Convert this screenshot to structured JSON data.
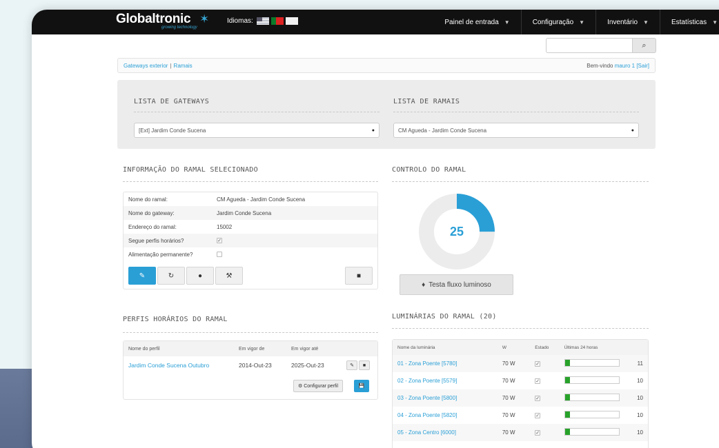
{
  "header": {
    "logo_text": "Globaltronic",
    "logo_sub": "growing technology",
    "idiomas_label": "Idiomas:",
    "nav": [
      {
        "label": "Painel de entrada"
      },
      {
        "label": "Configuração"
      },
      {
        "label": "Inventário"
      },
      {
        "label": "Estatísticas"
      }
    ]
  },
  "search": {
    "placeholder": "",
    "button_icon": "search-icon"
  },
  "breadcrumb": {
    "item1": "Gateways exterior",
    "sep": "|",
    "item2": "Ramais"
  },
  "welcome": {
    "prefix": "Bem-vindo",
    "user": "mauro 1",
    "logout": "[Sair]"
  },
  "gateways_panel": {
    "title_gateways": "LISTA DE GATEWAYS",
    "title_ramais": "LISTA DE RAMAIS",
    "gateway_selected": "[Ext] Jardim Conde Sucena",
    "ramal_selected": "CM Agueda - Jardim Conde Sucena"
  },
  "info": {
    "title": "INFORMAÇÃO DO RAMAL SELECIONADO",
    "rows": [
      {
        "key": "Nome do ramal:",
        "value": "CM Agueda - Jardim Conde Sucena"
      },
      {
        "key": "Nome do gateway:",
        "value": "Jardim Conde Sucena"
      },
      {
        "key": "Endereço do ramal:",
        "value": "15002"
      },
      {
        "key": "Segue perfis horários?",
        "value": "✓"
      },
      {
        "key": "Alimentação permanente?",
        "value": ""
      }
    ]
  },
  "controlo": {
    "title": "CONTROLO DO RAMAL",
    "value": "25",
    "test_button": "Testa fluxo luminoso"
  },
  "perfis": {
    "title": "PERFIS HORÁRIOS DO RAMAL",
    "headers": [
      "Nome do perfil",
      "Em vigor de",
      "Em vigor até"
    ],
    "rows": [
      {
        "name": "Jardim Conde Sucena Outubro",
        "from": "2014-Out-23",
        "to": "2025-Out-23"
      }
    ],
    "config_button": "Configurar perfil"
  },
  "luminarias": {
    "title": "LUMINÁRIAS DO RAMAL (20)",
    "headers": [
      "Nome da luminária",
      "W",
      "Estado",
      "Últimas 24 horas",
      ""
    ],
    "rows": [
      {
        "name": "01 - Zona Poente [5780]",
        "w": "70 W",
        "value": "11",
        "level": 0.1
      },
      {
        "name": "02 - Zona Poente [5579]",
        "w": "70 W",
        "value": "10",
        "level": 0.1
      },
      {
        "name": "03 - Zona Poente [5800]",
        "w": "70 W",
        "value": "10",
        "level": 0.1
      },
      {
        "name": "04 - Zona Poente [5820]",
        "w": "70 W",
        "value": "10",
        "level": 0.1
      },
      {
        "name": "05 - Zona Centro [6000]",
        "w": "70 W",
        "value": "10",
        "level": 0.1
      }
    ]
  },
  "colors": {
    "accent": "#2a9fd6",
    "bar": "#28a22a",
    "topbar": "#111111"
  }
}
